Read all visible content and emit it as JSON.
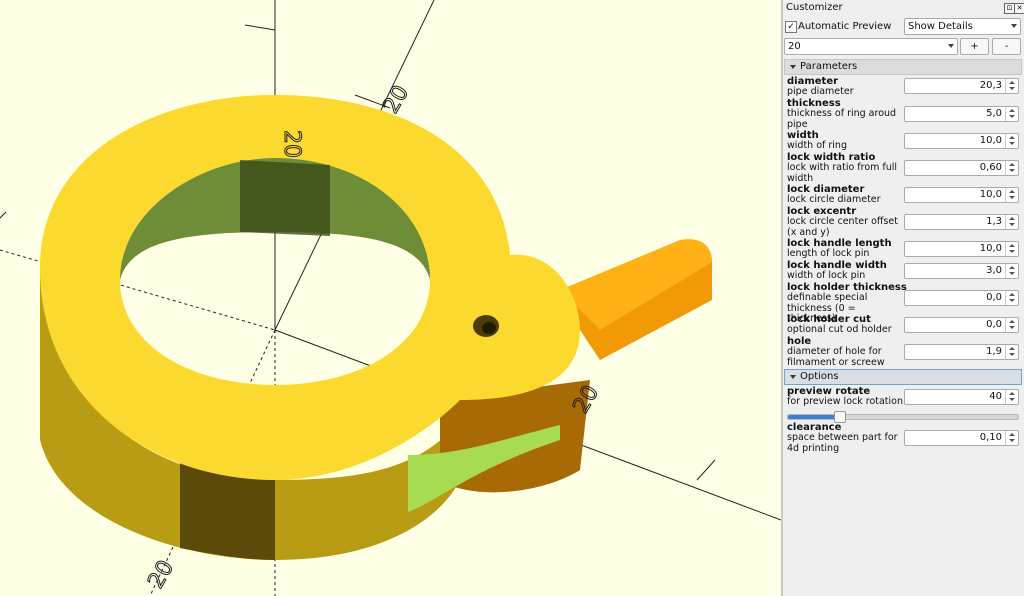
{
  "viewport": {
    "axis_labels": [
      "20",
      "20",
      "20",
      "20"
    ],
    "colors": {
      "background": "#ffffe5",
      "ring_top": "#fbd92f",
      "ring_side": "#b59a13",
      "handle": "#f5a10a",
      "inner": "#6f8e37",
      "clip": "#a6dd52"
    }
  },
  "panel": {
    "title": "Customizer",
    "automatic_preview": {
      "label": "Automatic Preview",
      "checked": "✓"
    },
    "show_details": "Show Details",
    "preset": "20",
    "add_button": "+",
    "remove_button": "-",
    "parameters_section": "Parameters",
    "options_section": "Options",
    "parameters": [
      {
        "name": "diameter",
        "desc": "pipe diameter",
        "value": "20,3"
      },
      {
        "name": "thickness",
        "desc": "thickness of ring aroud pipe",
        "value": "5,0"
      },
      {
        "name": "width",
        "desc": "width of ring",
        "value": "10,0"
      },
      {
        "name": "lock width ratio",
        "desc": "lock with ratio from full width",
        "value": "0,60"
      },
      {
        "name": "lock diameter",
        "desc": "lock circle diameter",
        "value": "10,0"
      },
      {
        "name": "lock excentr",
        "desc": "lock circle center offset (x and y)",
        "value": "1,3"
      },
      {
        "name": "lock handle length",
        "desc": "length of lock pin",
        "value": "10,0"
      },
      {
        "name": "lock handle width",
        "desc": "width of lock pin",
        "value": "3,0"
      },
      {
        "name": "lock holder thickness",
        "desc": "definable special thickness (0 = thickness)",
        "value": "0,0"
      },
      {
        "name": "lock holder cut",
        "desc": "optional cut od holder",
        "value": "0,0"
      },
      {
        "name": "hole",
        "desc": "diameter of hole for filmament or screew",
        "value": "1,9"
      }
    ],
    "options": [
      {
        "name": "preview rotate",
        "desc": "for preview lock rotation",
        "value": "40",
        "slider_fraction": 0.22
      },
      {
        "name": "clearance",
        "desc": "space between part for 4d printing",
        "value": "0,10"
      }
    ]
  }
}
